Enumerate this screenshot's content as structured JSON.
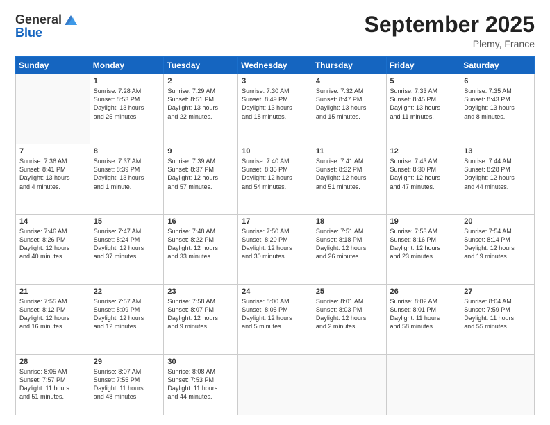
{
  "header": {
    "logo_general": "General",
    "logo_blue": "Blue",
    "month_title": "September 2025",
    "location": "Plemy, France"
  },
  "days_of_week": [
    "Sunday",
    "Monday",
    "Tuesday",
    "Wednesday",
    "Thursday",
    "Friday",
    "Saturday"
  ],
  "weeks": [
    [
      {
        "day": "",
        "info": ""
      },
      {
        "day": "1",
        "info": "Sunrise: 7:28 AM\nSunset: 8:53 PM\nDaylight: 13 hours\nand 25 minutes."
      },
      {
        "day": "2",
        "info": "Sunrise: 7:29 AM\nSunset: 8:51 PM\nDaylight: 13 hours\nand 22 minutes."
      },
      {
        "day": "3",
        "info": "Sunrise: 7:30 AM\nSunset: 8:49 PM\nDaylight: 13 hours\nand 18 minutes."
      },
      {
        "day": "4",
        "info": "Sunrise: 7:32 AM\nSunset: 8:47 PM\nDaylight: 13 hours\nand 15 minutes."
      },
      {
        "day": "5",
        "info": "Sunrise: 7:33 AM\nSunset: 8:45 PM\nDaylight: 13 hours\nand 11 minutes."
      },
      {
        "day": "6",
        "info": "Sunrise: 7:35 AM\nSunset: 8:43 PM\nDaylight: 13 hours\nand 8 minutes."
      }
    ],
    [
      {
        "day": "7",
        "info": "Sunrise: 7:36 AM\nSunset: 8:41 PM\nDaylight: 13 hours\nand 4 minutes."
      },
      {
        "day": "8",
        "info": "Sunrise: 7:37 AM\nSunset: 8:39 PM\nDaylight: 13 hours\nand 1 minute."
      },
      {
        "day": "9",
        "info": "Sunrise: 7:39 AM\nSunset: 8:37 PM\nDaylight: 12 hours\nand 57 minutes."
      },
      {
        "day": "10",
        "info": "Sunrise: 7:40 AM\nSunset: 8:35 PM\nDaylight: 12 hours\nand 54 minutes."
      },
      {
        "day": "11",
        "info": "Sunrise: 7:41 AM\nSunset: 8:32 PM\nDaylight: 12 hours\nand 51 minutes."
      },
      {
        "day": "12",
        "info": "Sunrise: 7:43 AM\nSunset: 8:30 PM\nDaylight: 12 hours\nand 47 minutes."
      },
      {
        "day": "13",
        "info": "Sunrise: 7:44 AM\nSunset: 8:28 PM\nDaylight: 12 hours\nand 44 minutes."
      }
    ],
    [
      {
        "day": "14",
        "info": "Sunrise: 7:46 AM\nSunset: 8:26 PM\nDaylight: 12 hours\nand 40 minutes."
      },
      {
        "day": "15",
        "info": "Sunrise: 7:47 AM\nSunset: 8:24 PM\nDaylight: 12 hours\nand 37 minutes."
      },
      {
        "day": "16",
        "info": "Sunrise: 7:48 AM\nSunset: 8:22 PM\nDaylight: 12 hours\nand 33 minutes."
      },
      {
        "day": "17",
        "info": "Sunrise: 7:50 AM\nSunset: 8:20 PM\nDaylight: 12 hours\nand 30 minutes."
      },
      {
        "day": "18",
        "info": "Sunrise: 7:51 AM\nSunset: 8:18 PM\nDaylight: 12 hours\nand 26 minutes."
      },
      {
        "day": "19",
        "info": "Sunrise: 7:53 AM\nSunset: 8:16 PM\nDaylight: 12 hours\nand 23 minutes."
      },
      {
        "day": "20",
        "info": "Sunrise: 7:54 AM\nSunset: 8:14 PM\nDaylight: 12 hours\nand 19 minutes."
      }
    ],
    [
      {
        "day": "21",
        "info": "Sunrise: 7:55 AM\nSunset: 8:12 PM\nDaylight: 12 hours\nand 16 minutes."
      },
      {
        "day": "22",
        "info": "Sunrise: 7:57 AM\nSunset: 8:09 PM\nDaylight: 12 hours\nand 12 minutes."
      },
      {
        "day": "23",
        "info": "Sunrise: 7:58 AM\nSunset: 8:07 PM\nDaylight: 12 hours\nand 9 minutes."
      },
      {
        "day": "24",
        "info": "Sunrise: 8:00 AM\nSunset: 8:05 PM\nDaylight: 12 hours\nand 5 minutes."
      },
      {
        "day": "25",
        "info": "Sunrise: 8:01 AM\nSunset: 8:03 PM\nDaylight: 12 hours\nand 2 minutes."
      },
      {
        "day": "26",
        "info": "Sunrise: 8:02 AM\nSunset: 8:01 PM\nDaylight: 11 hours\nand 58 minutes."
      },
      {
        "day": "27",
        "info": "Sunrise: 8:04 AM\nSunset: 7:59 PM\nDaylight: 11 hours\nand 55 minutes."
      }
    ],
    [
      {
        "day": "28",
        "info": "Sunrise: 8:05 AM\nSunset: 7:57 PM\nDaylight: 11 hours\nand 51 minutes."
      },
      {
        "day": "29",
        "info": "Sunrise: 8:07 AM\nSunset: 7:55 PM\nDaylight: 11 hours\nand 48 minutes."
      },
      {
        "day": "30",
        "info": "Sunrise: 8:08 AM\nSunset: 7:53 PM\nDaylight: 11 hours\nand 44 minutes."
      },
      {
        "day": "",
        "info": ""
      },
      {
        "day": "",
        "info": ""
      },
      {
        "day": "",
        "info": ""
      },
      {
        "day": "",
        "info": ""
      }
    ]
  ]
}
